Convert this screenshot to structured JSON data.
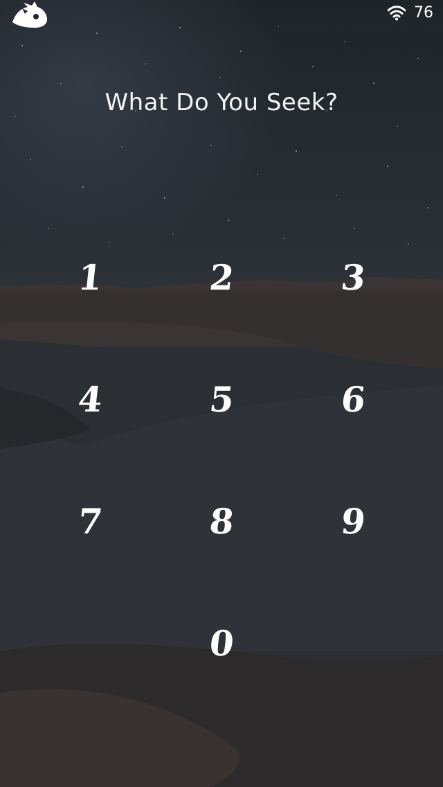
{
  "status_bar": {
    "battery_level": "76",
    "icons": [
      "sonic-logo-icon",
      "wifi-icon"
    ]
  },
  "lock_screen": {
    "prompt": "What Do You Seek?"
  },
  "keypad": {
    "keys": [
      {
        "label": "1"
      },
      {
        "label": "2"
      },
      {
        "label": "3"
      },
      {
        "label": "4"
      },
      {
        "label": "5"
      },
      {
        "label": "6"
      },
      {
        "label": "7"
      },
      {
        "label": "8"
      },
      {
        "label": "9"
      },
      {
        "label": "0"
      }
    ]
  },
  "colors": {
    "text": "#ffffff",
    "sky": "#22272d",
    "ground": "#2a2e33"
  }
}
